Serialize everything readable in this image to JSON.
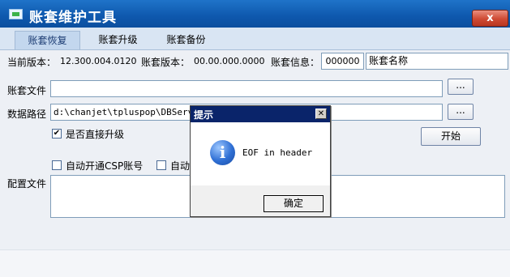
{
  "window": {
    "title": "账套维护工具",
    "close_label": "x"
  },
  "tabs": [
    {
      "label": "账套恢复",
      "active": true
    },
    {
      "label": "账套升级",
      "active": false
    },
    {
      "label": "账套备份",
      "active": false
    }
  ],
  "info_row": {
    "current_version_label": "当前版本：",
    "current_version_value": "12.300.004.0120",
    "account_version_label": "账套版本：",
    "account_version_value": "00.00.000.0000",
    "account_info_label": "账套信息：",
    "account_code": "000000",
    "account_name": "账套名称"
  },
  "account_file": {
    "label": "账套文件",
    "value": "",
    "browse_label": "..."
  },
  "data_path": {
    "label": "数据路径",
    "value": "d:\\chanjet\\tpluspop\\DBServer",
    "browse_label": "..."
  },
  "direct_upgrade": {
    "label": "是否直接升级",
    "checked": true
  },
  "start_button": "开始",
  "options": {
    "auto_csp": {
      "label": "自动开通CSP账号",
      "checked": false
    },
    "auto_other": {
      "label": "自动",
      "checked": false
    }
  },
  "config_file": {
    "label": "配置文件",
    "value": ""
  },
  "dialog": {
    "title": "提示",
    "close_label": "✕",
    "icon": "info-icon",
    "message": "EOF in header",
    "ok_label": "确定"
  }
}
